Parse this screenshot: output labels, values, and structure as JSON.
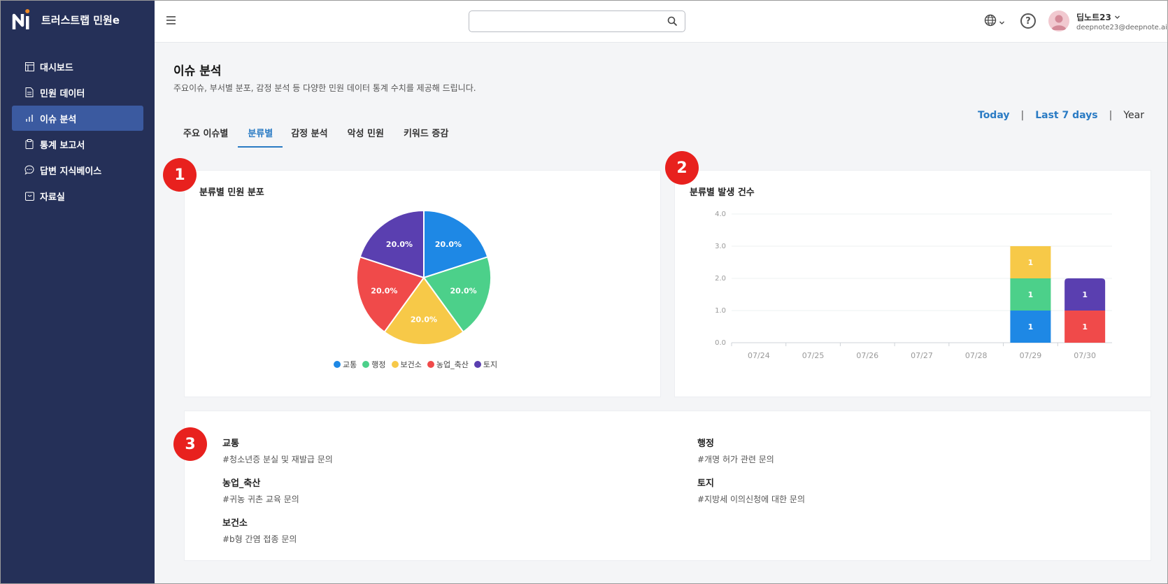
{
  "app": {
    "title": "트러스트랩 민원e"
  },
  "sidebar": {
    "items": [
      {
        "label": "대시보드",
        "icon": "dashboard-icon",
        "active": false
      },
      {
        "label": "민원 데이터",
        "icon": "document-icon",
        "active": false
      },
      {
        "label": "이슈 분석",
        "icon": "bar-chart-icon",
        "active": true
      },
      {
        "label": "통계 보고서",
        "icon": "clipboard-icon",
        "active": false
      },
      {
        "label": "답변 지식베이스",
        "icon": "chat-icon",
        "active": false
      },
      {
        "label": "자료실",
        "icon": "archive-icon",
        "active": false
      }
    ]
  },
  "header": {
    "search_placeholder": "",
    "user_name": "딥노트23",
    "user_email": "deepnote23@deepnote.ai",
    "help_label": "?"
  },
  "page": {
    "title": "이슈 분석",
    "description": "주요이슈, 부서별 분포, 감정 분석 등 다양한 민원 데이터 통계 수치를 제공해 드립니다.",
    "tabs": [
      {
        "label": "주요 이슈별",
        "active": false
      },
      {
        "label": "분류별",
        "active": true
      },
      {
        "label": "감정 분석",
        "active": false
      },
      {
        "label": "악성 민원",
        "active": false
      },
      {
        "label": "키워드 증감",
        "active": false
      }
    ],
    "range": {
      "today": "Today",
      "last7": "Last 7 days",
      "year": "Year",
      "sep": "|"
    }
  },
  "badges": [
    "1",
    "2",
    "3"
  ],
  "colors": {
    "교통": "#1e88e5",
    "행정": "#4cd08a",
    "보건소": "#f7c948",
    "농업_축산": "#f04a4a",
    "토지": "#5a3fb0",
    "accent": "#2a7bc4",
    "sidebar": "#253058",
    "badge": "#e8211e"
  },
  "chart_data": [
    {
      "type": "pie",
      "title": "분류별 민원 분포",
      "categories": [
        "교통",
        "행정",
        "보건소",
        "농업_축산",
        "토지"
      ],
      "values": [
        20.0,
        20.0,
        20.0,
        20.0,
        20.0
      ],
      "labels": [
        "20.0%",
        "20.0%",
        "20.0%",
        "20.0%",
        "20.0%"
      ],
      "legend_position": "bottom"
    },
    {
      "type": "bar",
      "stacked": true,
      "title": "분류별 발생 건수",
      "categories": [
        "07/24",
        "07/25",
        "07/26",
        "07/27",
        "07/28",
        "07/29",
        "07/30"
      ],
      "series": [
        {
          "name": "교통",
          "values": [
            0,
            0,
            0,
            0,
            0,
            1,
            0
          ]
        },
        {
          "name": "행정",
          "values": [
            0,
            0,
            0,
            0,
            0,
            1,
            0
          ]
        },
        {
          "name": "보건소",
          "values": [
            0,
            0,
            0,
            0,
            0,
            1,
            0
          ]
        },
        {
          "name": "농업_축산",
          "values": [
            0,
            0,
            0,
            0,
            0,
            0,
            1
          ]
        },
        {
          "name": "토지",
          "values": [
            0,
            0,
            0,
            0,
            0,
            0,
            1
          ]
        }
      ],
      "yticks": [
        "0.0",
        "1.0",
        "2.0",
        "3.0",
        "4.0"
      ],
      "ylim": [
        0,
        4
      ],
      "grid": true
    }
  ],
  "issues": [
    {
      "category": "교통",
      "tag": "#청소년증 분실 및 재발급 문의"
    },
    {
      "category": "행정",
      "tag": "#개명 허가 관련 문의"
    },
    {
      "category": "농업_축산",
      "tag": "#귀농 귀촌 교육 문의"
    },
    {
      "category": "토지",
      "tag": "#지방세 이의신청에 대한 문의"
    },
    {
      "category": "보건소",
      "tag": "#b형 간염 접종 문의"
    }
  ]
}
